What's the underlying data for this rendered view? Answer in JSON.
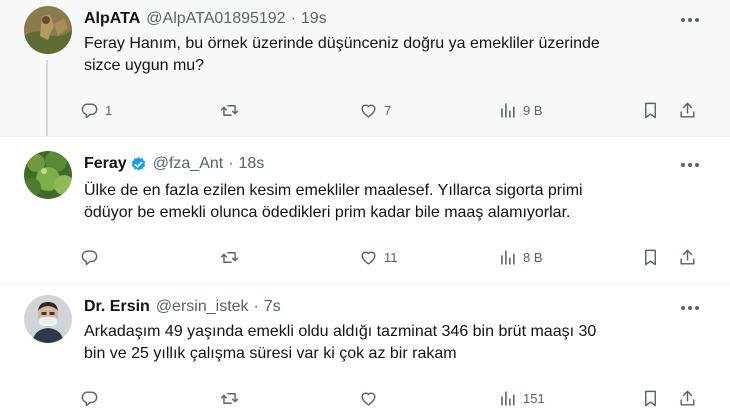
{
  "tweets": [
    {
      "name": "AlpATA",
      "verified": false,
      "handle": "@AlpATA01895192",
      "dot": "·",
      "time": "19s",
      "lines": [
        "Feray Hanım, bu örnek üzerinde düşünceniz doğru ya emekliler üzerinde",
        "sizce uygun mu?"
      ],
      "reply_count": "1",
      "retweet_count": "",
      "like_count": "7",
      "views_count": "9 B",
      "liked": false
    },
    {
      "name": "Feray",
      "verified": true,
      "handle": "@fza_Ant",
      "dot": "·",
      "time": "18s",
      "lines": [
        "Ülke de en fazla ezilen kesim emekliler maalesef. Yıllarca sigorta primi",
        "ödüyor be emekli olunca ödedikleri prim kadar bile maaş alamıyorlar."
      ],
      "reply_count": "",
      "retweet_count": "",
      "like_count": "11",
      "views_count": "8 B"
    },
    {
      "name": "Dr. Ersin",
      "verified": false,
      "handle": "@ersin_istek",
      "dot": "·",
      "time": "7s",
      "lines": [
        "Arkadaşım 49 yaşında emekli oldu aldığı tazminat 346 bin brüt maaşı 30",
        "bin ve 25 yıllık çalışma süresi var ki çok az bir rakam"
      ],
      "reply_count": "",
      "retweet_count": "",
      "like_count": "",
      "views_count": "151"
    }
  ],
  "colors": {
    "text": "#0f1419",
    "secondary": "#536471",
    "verified": "#1d9bf0",
    "highlight_bg": "#f7f9f9",
    "thread_line": "#cfd9de"
  },
  "icons": [
    "reply-icon",
    "retweet-icon",
    "like-icon",
    "views-icon",
    "bookmark-icon",
    "share-icon",
    "more-icon",
    "verified-badge-icon"
  ]
}
